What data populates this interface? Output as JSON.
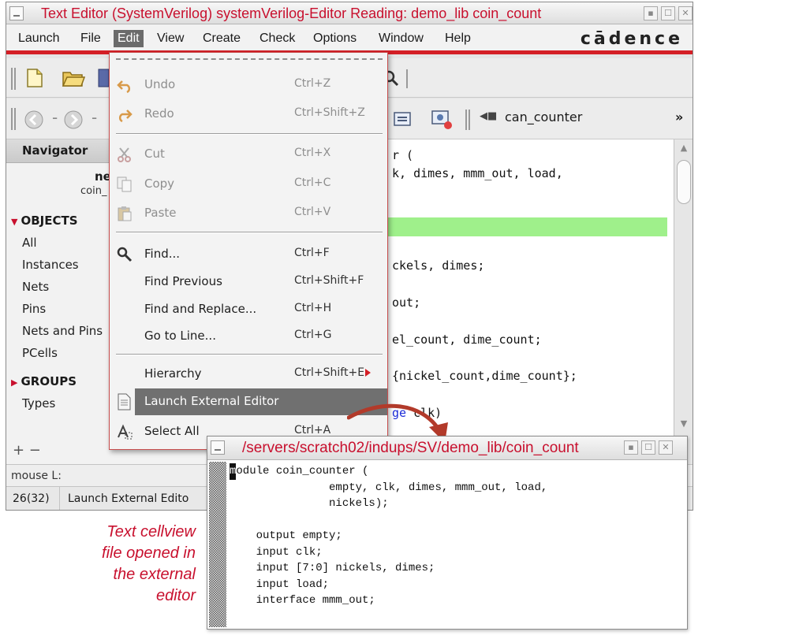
{
  "main_window": {
    "title": "Text Editor (SystemVerilog) systemVerilog-Editor Reading: demo_lib coin_count",
    "menu": [
      "Launch",
      "File",
      "Edit",
      "View",
      "Create",
      "Check",
      "Options",
      "Window",
      "Help"
    ],
    "active_menu": "Edit",
    "brand": "cādence"
  },
  "toolbar": {
    "cell_selector_label": "can_counter",
    "overflow": "»"
  },
  "navigator": {
    "header": "Navigator",
    "name_line1": "ne",
    "name_line2": "coin_",
    "objects_label": "OBJECTS",
    "objects": [
      "All",
      "Instances",
      "Nets",
      "Pins",
      "Nets and Pins",
      "PCells"
    ],
    "groups_label": "GROUPS",
    "groups": [
      "Types"
    ],
    "footer": "+ −"
  },
  "editor_lines": {
    "l1": "r (",
    "l2": "k, dimes, mmm_out, load,",
    "l3": "ckels, dimes;",
    "l4": "out;",
    "l5": "el_count, dime_count;",
    "l6": "{nickel_count,dime_count};",
    "l7a": "ge",
    "l7b": " clk)"
  },
  "status": {
    "mouse": "mouse L:",
    "line_count": "26(32)",
    "last_command": "Launch External Edito"
  },
  "edit_menu": {
    "items": [
      {
        "label": "Undo",
        "shortcut": "Ctrl+Z",
        "icon": "undo-icon",
        "enabled": false
      },
      {
        "label": "Redo",
        "shortcut": "Ctrl+Shift+Z",
        "icon": "redo-icon",
        "enabled": false
      },
      {
        "label": "Cut",
        "shortcut": "Ctrl+X",
        "icon": "cut-icon",
        "enabled": false
      },
      {
        "label": "Copy",
        "shortcut": "Ctrl+C",
        "icon": "copy-icon",
        "enabled": false
      },
      {
        "label": "Paste",
        "shortcut": "Ctrl+V",
        "icon": "paste-icon",
        "enabled": false
      },
      {
        "label": "Find...",
        "shortcut": "Ctrl+F",
        "icon": "search-icon",
        "enabled": true
      },
      {
        "label": "Find Previous",
        "shortcut": "Ctrl+Shift+F",
        "icon": "",
        "enabled": true
      },
      {
        "label": "Find and Replace...",
        "shortcut": "Ctrl+H",
        "icon": "",
        "enabled": true
      },
      {
        "label": "Go to Line...",
        "shortcut": "Ctrl+G",
        "icon": "",
        "enabled": true
      },
      {
        "label": "Hierarchy",
        "shortcut": "Ctrl+Shift+E",
        "icon": "",
        "enabled": true
      },
      {
        "label": "Launch External Editor",
        "shortcut": "",
        "icon": "document-icon",
        "enabled": true,
        "selected": true
      },
      {
        "label": "Select All",
        "shortcut": "Ctrl+A",
        "icon": "select-all-icon",
        "enabled": true
      }
    ]
  },
  "external_editor": {
    "title": "/servers/scratch02/indups/SV/demo_lib/coin_count",
    "cursor_char": "m",
    "first_line_rest": "odule coin_counter (",
    "lines": [
      "               empty, clk, dimes, mmm_out, load,",
      "               nickels);",
      "",
      "    output empty;",
      "    input clk;",
      "    input [7:0] nickels, dimes;",
      "    input load;",
      "    interface mmm_out;"
    ]
  },
  "caption": [
    "Text cellview",
    "file opened in",
    "the external",
    "editor"
  ],
  "colors": {
    "accent_red": "#d41f26",
    "title_red": "#c8102e",
    "highlight_green": "#9ff08b",
    "menu_selected": "#707070"
  }
}
